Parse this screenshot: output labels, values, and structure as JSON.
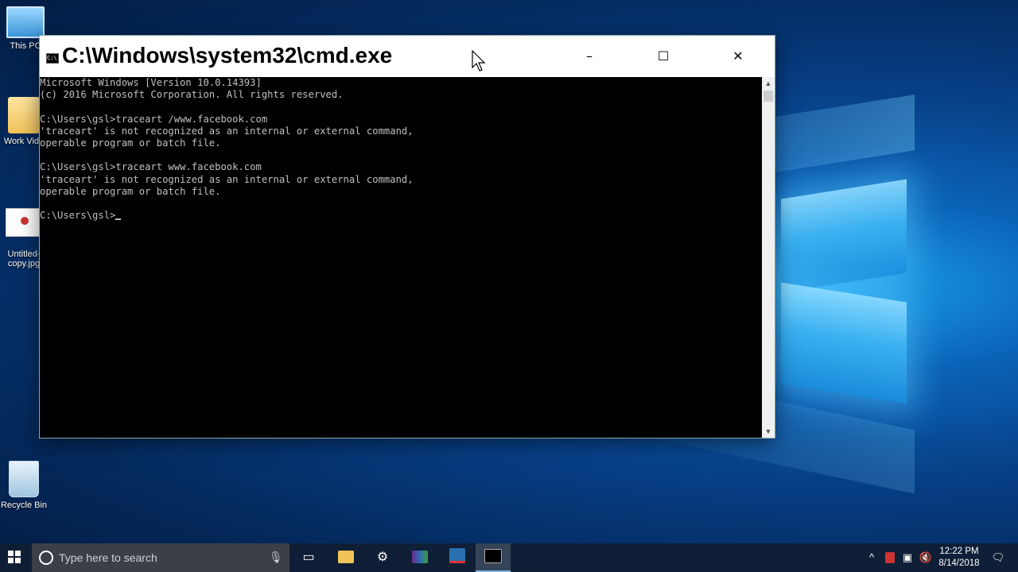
{
  "desktop": {
    "icons": [
      {
        "label": "This PC",
        "icon": "this-pc-icon"
      },
      {
        "label": "Work Vide",
        "icon": "folder-icon"
      },
      {
        "label": "Untitled-\ncopy.jpg",
        "icon": "image-file-icon"
      },
      {
        "label": "Recycle Bin",
        "icon": "recycle-bin-icon"
      }
    ]
  },
  "window": {
    "title": "C:\\Windows\\system32\\cmd.exe",
    "icon": "cmd-icon",
    "minimize_glyph": "–",
    "maximize_glyph": "☐",
    "close_glyph": "✕"
  },
  "console": {
    "lines": [
      "Microsoft Windows [Version 10.0.14393]",
      "(c) 2016 Microsoft Corporation. All rights reserved.",
      "",
      "C:\\Users\\gsl>traceart /www.facebook.com",
      "'traceart' is not recognized as an internal or external command,",
      "operable program or batch file.",
      "",
      "C:\\Users\\gsl>traceart www.facebook.com",
      "'traceart' is not recognized as an internal or external command,",
      "operable program or batch file.",
      "",
      "C:\\Users\\gsl>"
    ]
  },
  "taskbar": {
    "search_placeholder": "Type here to search",
    "start_icon": "windows-start-icon",
    "pinned": [
      {
        "name": "task-view",
        "icon": "task-view-icon"
      },
      {
        "name": "file-explorer",
        "icon": "folder-icon"
      },
      {
        "name": "settings",
        "icon": "gear-icon"
      },
      {
        "name": "winrar",
        "icon": "winrar-icon"
      },
      {
        "name": "app",
        "icon": "app-icon"
      },
      {
        "name": "command-prompt",
        "icon": "cmd-icon",
        "active": true
      }
    ],
    "clock": {
      "time": "12:22 PM",
      "date": "8/14/2018"
    }
  },
  "colors": {
    "console_bg": "#000000",
    "console_fg": "#c0c0c0",
    "taskbar_bg": "#101e34",
    "desktop_accent": "#1aa0ea"
  }
}
